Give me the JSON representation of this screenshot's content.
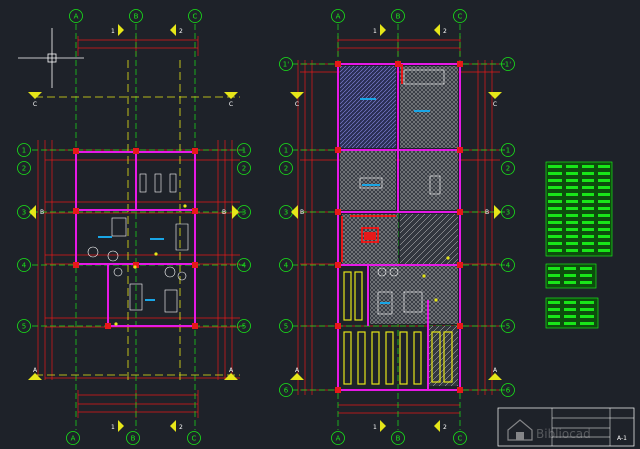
{
  "drawing": {
    "grid_letters": [
      "A",
      "B",
      "C"
    ],
    "grid_numbers": [
      "1",
      "2",
      "3",
      "4",
      "5"
    ],
    "right_plan_numbers": [
      "1'",
      "1",
      "2",
      "3",
      "4",
      "5",
      "6"
    ],
    "section_marks": {
      "c": "C",
      "a": "A",
      "b": "B"
    },
    "cut_marks": {
      "one": "1",
      "two": "2"
    },
    "sheet_number": "A-1",
    "watermark": "Bibliocad"
  },
  "colors": {
    "background": "#1e2229",
    "grid_green": "#19e619",
    "wall_magenta": "#e619e6",
    "dim_red": "#e61919",
    "axis_yellow": "#e6e619",
    "white": "#ffffff"
  }
}
